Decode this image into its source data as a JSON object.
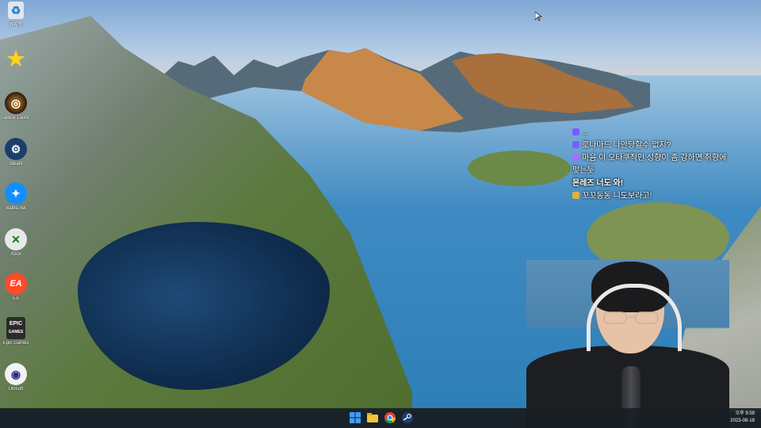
{
  "desktop": {
    "icons": [
      {
        "name": "recycle-bin",
        "label": "휴지통"
      },
      {
        "name": "favorites",
        "label": ""
      },
      {
        "name": "app-orange-swirl",
        "label": "Tarkov Launcher"
      },
      {
        "name": "steam",
        "label": "Steam"
      },
      {
        "name": "battle-net",
        "label": "Battle.net"
      },
      {
        "name": "xbox",
        "label": "Xbox"
      },
      {
        "name": "ea",
        "label": "EA"
      },
      {
        "name": "epic-games",
        "label": "Epic Games"
      },
      {
        "name": "ubisoft",
        "label": "Ubisoft"
      }
    ],
    "epic_text_top": "EPIC",
    "epic_text_bottom": "GAMES",
    "ea_text": "EA"
  },
  "chat": {
    "messages": [
      {
        "nick": "",
        "text": "...",
        "badge_color": "#7c5cff"
      },
      {
        "nick": "",
        "text": "로나마드 나만당할수 없지?",
        "badge_color": "#7c5cff"
      },
      {
        "nick": "",
        "text": "마음 이 오타쿠적인 성향이 좀 강하면 취향에",
        "badge_color": "#a070ff"
      },
      {
        "nick": "",
        "text": "맞는듯",
        "badge_color": ""
      },
      {
        "nick": "",
        "text": "몬레즈 너도 와!",
        "badge_color": ""
      },
      {
        "nick": "",
        "text": "꼬꼬동동 니도보라고!",
        "badge_color": "#e0b040"
      }
    ]
  },
  "taskbar": {
    "apps": [
      "windows-start",
      "file-explorer",
      "chrome",
      "steam"
    ],
    "clock_time": "오후 9:59",
    "clock_date": "2023-08-18"
  },
  "colors": {
    "taskbar": "#181e24",
    "chat_text": "#ffffff"
  }
}
